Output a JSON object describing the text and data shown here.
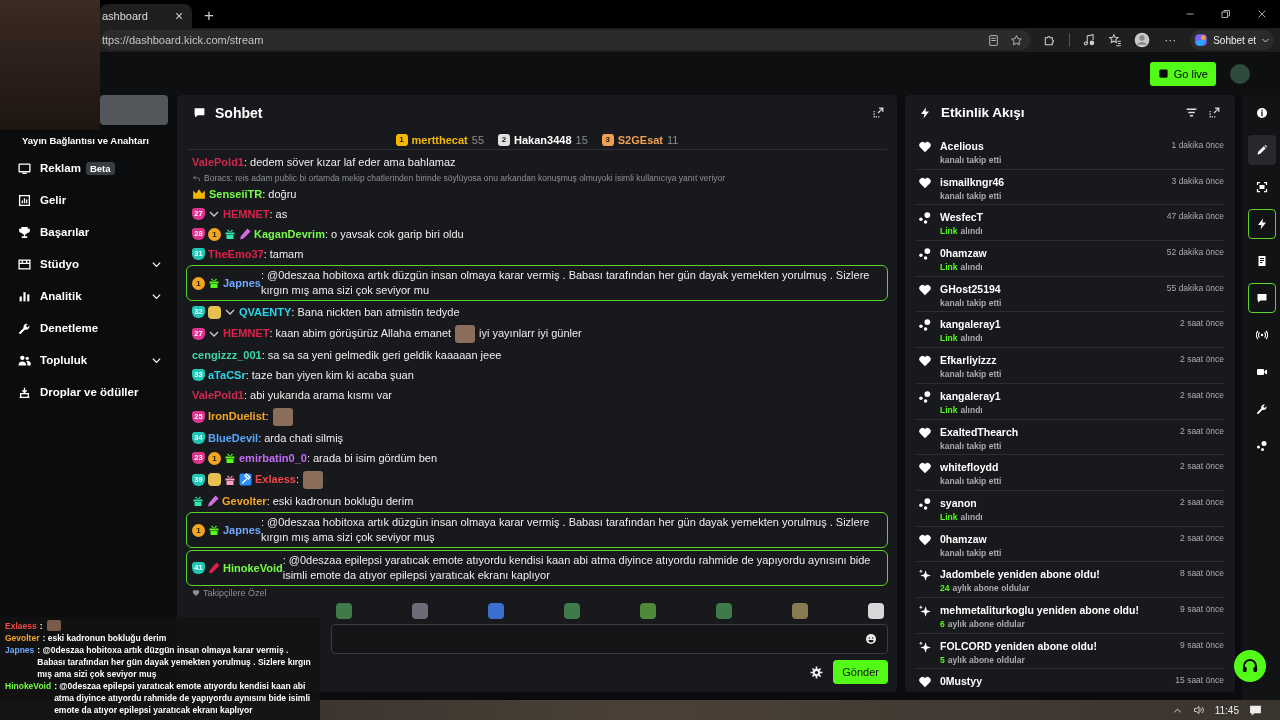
{
  "browser": {
    "tab": {
      "title": "ashboard",
      "close": "×"
    },
    "new_tab": "+",
    "url": "ttps://dashboard.kick.com/stream",
    "more": "···",
    "copilot": "Sohbet et"
  },
  "header": {
    "go_live": "Go live"
  },
  "sidebar": {
    "title": "Yayın Bağlantısı ve Anahtarı",
    "items": [
      {
        "label": "Reklam",
        "kind": "tv",
        "badge": "Beta",
        "expandable": false
      },
      {
        "label": "Gelir",
        "kind": "chart",
        "expandable": false
      },
      {
        "label": "Başarılar",
        "kind": "trophy",
        "expandable": false
      },
      {
        "label": "Stüdyo",
        "kind": "film",
        "expandable": true
      },
      {
        "label": "Analitik",
        "kind": "bars",
        "expandable": true
      },
      {
        "label": "Denetleme",
        "kind": "wrench",
        "expandable": false
      },
      {
        "label": "Topluluk",
        "kind": "people",
        "expandable": true
      },
      {
        "label": "Droplar ve ödüller",
        "kind": "tray",
        "expandable": false
      }
    ]
  },
  "chat": {
    "title": "Sohbet",
    "leaders": [
      {
        "rank": "1",
        "name": "mertthecat",
        "count": "55",
        "color": "#f5b800"
      },
      {
        "rank": "2",
        "name": "Hakan3448",
        "count": "15",
        "color": "#e0e0e0"
      },
      {
        "rank": "3",
        "name": "S2GEsat",
        "count": "11",
        "color": "#f0a050"
      }
    ],
    "messages": [
      {
        "kind": "message",
        "user": "ValePold1",
        "color": "#d0284f",
        "parts": [
          {
            "kind": "text",
            "text": ": dedem söver kızar laf eder ama bahlamaz"
          }
        ],
        "highlighted": false
      },
      {
        "kind": "reply",
        "text": "Boracs: reis adam public bi ortamda mekip chatlerinden birinde söylüyosa onu arkandan konuşmuş olmuyoki isimli kullanıcıya yanıt veriyor"
      },
      {
        "kind": "message",
        "badges": [
          {
            "kind": "crown"
          }
        ],
        "user": "SenseiiTR",
        "color": "#75fd46",
        "parts": [
          {
            "kind": "text",
            "text": ": doğru"
          }
        ],
        "highlighted": false
      },
      {
        "kind": "message",
        "badges": [
          {
            "kind": "sub",
            "text": "27",
            "color": "#e0338f"
          },
          {
            "kind": "chevron"
          }
        ],
        "user": "HEMNET",
        "color": "#e0204a",
        "parts": [
          {
            "kind": "text",
            "text": ": as"
          }
        ],
        "highlighted": false
      },
      {
        "kind": "message",
        "badges": [
          {
            "kind": "sub",
            "text": "28",
            "color": "#e0338f"
          },
          {
            "kind": "gifter",
            "text": "1"
          },
          {
            "kind": "gift",
            "color": "#2ee6b0"
          },
          {
            "kind": "pen",
            "color": "#d46ee0"
          }
        ],
        "user": "KaganDevrim",
        "color": "#75fd46",
        "parts": [
          {
            "kind": "text",
            "text": ": o yavsak cok garip biri oldu"
          }
        ],
        "highlighted": false
      },
      {
        "kind": "message",
        "badges": [
          {
            "kind": "sub",
            "text": "31",
            "color": "#1fc7b7"
          }
        ],
        "user": "TheEmo37",
        "color": "#e0204a",
        "parts": [
          {
            "kind": "text",
            "text": ": tamam"
          }
        ],
        "highlighted": false
      },
      {
        "kind": "message",
        "badges": [
          {
            "kind": "gifter",
            "text": "1"
          },
          {
            "kind": "gift",
            "color": "#53fc18"
          }
        ],
        "user": "Japnes",
        "color": "#6fa8ff",
        "parts": [
          {
            "kind": "text",
            "text": ": @0deszaa hobitoxa artık düzgün insan olmaya karar vermiş . Babası tarafından her gün dayak yemekten yorulmuş . Sizlere kırgın mış ama sizi çok seviyor mu"
          }
        ],
        "highlighted": true
      },
      {
        "kind": "message",
        "badges": [
          {
            "kind": "sub",
            "text": "32",
            "color": "#1fc7b7"
          },
          {
            "kind": "emote"
          },
          {
            "kind": "chevron"
          }
        ],
        "user": "QVAENTY",
        "color": "#2cd4e8",
        "parts": [
          {
            "kind": "text",
            "text": ": Bana nickten ban atmistin tedyde"
          }
        ],
        "highlighted": false
      },
      {
        "kind": "message",
        "badges": [
          {
            "kind": "sub",
            "text": "27",
            "color": "#e0338f"
          },
          {
            "kind": "chevron"
          }
        ],
        "user": "HEMNET",
        "color": "#e0204a",
        "parts": [
          {
            "kind": "text",
            "text": ": kaan abim görüşürüz Allaha emanet"
          },
          {
            "kind": "emote"
          },
          {
            "kind": "text",
            "text": "iyi yayınlarr iyi günler"
          }
        ],
        "highlighted": false
      },
      {
        "kind": "message",
        "user": "cengizzz_001",
        "color": "#3fd6a6",
        "parts": [
          {
            "kind": "text",
            "text": ": sa sa sa yeni gelmedik geri geldik kaaaaan jeee"
          }
        ],
        "highlighted": false
      },
      {
        "kind": "message",
        "badges": [
          {
            "kind": "sub",
            "text": "33",
            "color": "#1fc7b7"
          }
        ],
        "user": "aTaCSr",
        "color": "#2cd4e8",
        "parts": [
          {
            "kind": "text",
            "text": ": taze ban yiyen kim ki acaba şuan"
          }
        ],
        "highlighted": false
      },
      {
        "kind": "message",
        "user": "ValePold1",
        "color": "#d0284f",
        "parts": [
          {
            "kind": "text",
            "text": ": abi yukarıda arama kısmı var"
          }
        ],
        "highlighted": false
      },
      {
        "kind": "message",
        "badges": [
          {
            "kind": "sub",
            "text": "25",
            "color": "#e0338f"
          }
        ],
        "user": "IronDuelist",
        "color": "#f5a623",
        "parts": [
          {
            "kind": "text",
            "text": ":"
          },
          {
            "kind": "emote"
          }
        ],
        "highlighted": false
      },
      {
        "kind": "message",
        "badges": [
          {
            "kind": "sub",
            "text": "34",
            "color": "#1fc7b7"
          }
        ],
        "user": "BlueDevil",
        "color": "#58a6ff",
        "parts": [
          {
            "kind": "text",
            "text": ": arda chati silmiş"
          }
        ],
        "highlighted": false
      },
      {
        "kind": "message",
        "badges": [
          {
            "kind": "sub",
            "text": "23",
            "color": "#e0338f"
          },
          {
            "kind": "gifter",
            "text": "1"
          },
          {
            "kind": "gift",
            "color": "#53fc18"
          }
        ],
        "user": "emirbatin0_0",
        "color": "#c46cf5",
        "parts": [
          {
            "kind": "text",
            "text": ": arada bi isim gördüm ben"
          }
        ],
        "highlighted": false
      },
      {
        "kind": "message",
        "badges": [
          {
            "kind": "sub",
            "text": "39",
            "color": "#1fc7b7"
          },
          {
            "kind": "emote"
          },
          {
            "kind": "gift",
            "color": "#ff9ec7"
          },
          {
            "kind": "hammer"
          }
        ],
        "user": "Exlaess",
        "color": "#f04848",
        "parts": [
          {
            "kind": "text",
            "text": ":"
          },
          {
            "kind": "emote"
          }
        ],
        "highlighted": false
      },
      {
        "kind": "message",
        "badges": [
          {
            "kind": "gift",
            "color": "#2ee6b0"
          },
          {
            "kind": "pen",
            "color": "#d46ee0"
          }
        ],
        "user": "Gevolter",
        "color": "#f5a623",
        "parts": [
          {
            "kind": "text",
            "text": ": eski kadronun bokluğu derim"
          }
        ],
        "highlighted": false
      },
      {
        "kind": "message",
        "badges": [
          {
            "kind": "gifter",
            "text": "1"
          },
          {
            "kind": "gift",
            "color": "#53fc18"
          }
        ],
        "user": "Japnes",
        "color": "#6fa8ff",
        "parts": [
          {
            "kind": "text",
            "text": ": @0deszaa hobitoxa artık düzgün insan olmaya karar vermiş . Babası tarafından her gün dayak yemekten yorulmuş . Sizlere kırgın mış ama sizi çok seviyor muş"
          }
        ],
        "highlighted": true
      },
      {
        "kind": "message",
        "badges": [
          {
            "kind": "sub",
            "text": "41",
            "color": "#1fc7b7"
          },
          {
            "kind": "pen",
            "color": "#e0204a"
          }
        ],
        "user": "HinokeVoid",
        "color": "#75fd46",
        "parts": [
          {
            "kind": "text",
            "text": ": @0deszaa epilepsi yaratıcak emote atıyordu kendisi kaan abi atma diyince atıyordu rahmide de yapıyordu aynısını bide isimli emote da atıyor epilepsi yaratıcak ekranı kaplıyor"
          }
        ],
        "highlighted": true
      }
    ],
    "followers_only": "Takipçilere Özel",
    "send": "Gönder"
  },
  "events": {
    "title": "Etkinlik Akışı",
    "items": [
      {
        "kind": "follow",
        "title": "Acelious",
        "time": "1 dakika önce",
        "detail": "kanalı takip etti"
      },
      {
        "kind": "follow",
        "title": "ismailkngr46",
        "time": "3 dakika önce",
        "detail": "kanalı takip etti"
      },
      {
        "kind": "link",
        "title": "WesfecT",
        "time": "47 dakika önce",
        "highlight": "Link",
        "detail": "alındı"
      },
      {
        "kind": "link",
        "title": "0hamzaw",
        "time": "52 dakika önce",
        "highlight": "Link",
        "detail": "alındı"
      },
      {
        "kind": "follow",
        "title": "GHost25194",
        "time": "55 dakika önce",
        "detail": "kanalı takip etti"
      },
      {
        "kind": "link",
        "title": "kangaleray1",
        "time": "2 saat önce",
        "highlight": "Link",
        "detail": "alındı"
      },
      {
        "kind": "follow",
        "title": "Efkarliyizzz",
        "time": "2 saat önce",
        "detail": "kanalı takip etti"
      },
      {
        "kind": "link",
        "title": "kangaleray1",
        "time": "2 saat önce",
        "highlight": "Link",
        "detail": "alındı"
      },
      {
        "kind": "follow",
        "title": "ExaltedThearch",
        "time": "2 saat önce",
        "detail": "kanalı takip etti"
      },
      {
        "kind": "follow",
        "title": "whitefloydd",
        "time": "2 saat önce",
        "detail": "kanalı takip etti"
      },
      {
        "kind": "link",
        "title": "syanon",
        "time": "2 saat önce",
        "highlight": "Link",
        "detail": "alındı"
      },
      {
        "kind": "follow",
        "title": "0hamzaw",
        "time": "2 saat önce",
        "detail": "kanalı takip etti"
      },
      {
        "kind": "resub",
        "title": "Jadombele yeniden abone oldu!",
        "time": "8 saat önce",
        "highlight": "24",
        "detail": "aylık abone oldular"
      },
      {
        "kind": "resub",
        "title": "mehmetaliturkoglu yeniden abone oldu!",
        "time": "9 saat önce",
        "highlight": "6",
        "detail": "aylık abone oldular"
      },
      {
        "kind": "resub",
        "title": "FOLCORD yeniden abone oldu!",
        "time": "9 saat önce",
        "highlight": "5",
        "detail": "aylık abone oldular"
      },
      {
        "kind": "follow",
        "title": "0Mustyy",
        "time": "15 saat önce"
      }
    ]
  },
  "rail": {
    "items": [
      {
        "kind": "info",
        "selected": false,
        "hovered": false
      },
      {
        "kind": "pencil",
        "selected": false,
        "hovered": true
      },
      {
        "kind": "frame",
        "selected": false,
        "hovered": false
      },
      {
        "kind": "bolt",
        "selected": true,
        "hovered": false
      },
      {
        "kind": "document",
        "selected": false,
        "hovered": false
      },
      {
        "kind": "chat",
        "selected": true,
        "hovered": false
      },
      {
        "kind": "broadcast",
        "selected": false,
        "hovered": false
      },
      {
        "kind": "camera",
        "selected": false,
        "hovered": false
      },
      {
        "kind": "wrench",
        "selected": false,
        "hovered": false
      },
      {
        "kind": "circles",
        "selected": false,
        "hovered": false
      }
    ]
  },
  "overlay": {
    "lines": [
      {
        "user": "Exlaess",
        "color": "#f04848",
        "text": ":",
        "emote": true
      },
      {
        "user": "Gevolter",
        "color": "#f5a623",
        "text": ": eski kadronun bokluğu derim"
      },
      {
        "user": "Japnes",
        "color": "#6fa8ff",
        "text": ": @0deszaa hobitoxa artık düzgün insan olmaya karar vermiş . Babası tarafından her gün dayak yemekten yorulmuş . Sizlere kırgın mış ama sizi çok seviyor muş"
      },
      {
        "user": "HinokeVoid",
        "color": "#75fd46",
        "text": ": @0deszaa epilepsi yaratıcak emote atıyordu kendisi kaan abi atma diyince atıyordu rahmide de yapıyordu aynısını bide isimli emote da atıyor epilepsi yaratıcak ekranı kaplıyor"
      }
    ]
  },
  "taskbar": {
    "time": "11:45"
  }
}
